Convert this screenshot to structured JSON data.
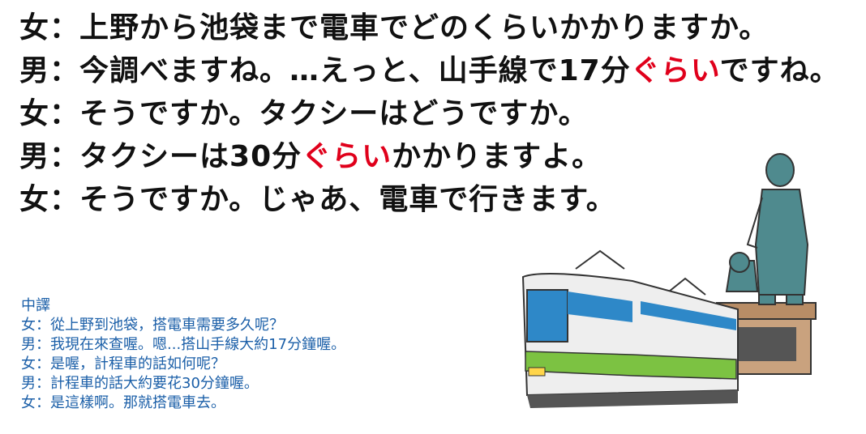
{
  "dialogue": [
    {
      "speaker": "女",
      "sep": "：",
      "segments": [
        {
          "text": "上野から池袋まで電車でどのくらいかかりますか。",
          "highlight": false
        }
      ]
    },
    {
      "speaker": "男",
      "sep": "：",
      "segments": [
        {
          "text": "今調べますね。…えっと、山手線で17分",
          "highlight": false
        },
        {
          "text": "ぐらい",
          "highlight": true
        },
        {
          "text": "ですね。",
          "highlight": false
        }
      ]
    },
    {
      "speaker": "女",
      "sep": "：",
      "segments": [
        {
          "text": "そうですか。タクシーはどうですか。",
          "highlight": false
        }
      ]
    },
    {
      "speaker": "男",
      "sep": "：",
      "segments": [
        {
          "text": "タクシーは30分",
          "highlight": false
        },
        {
          "text": "ぐらい",
          "highlight": true
        },
        {
          "text": "かかりますよ。",
          "highlight": false
        }
      ]
    },
    {
      "speaker": "女",
      "sep": "：",
      "segments": [
        {
          "text": "そうですか。じゃあ、電車で行きます。",
          "highlight": false
        }
      ]
    }
  ],
  "translation": {
    "heading": "中譯",
    "lines": [
      "女：從上野到池袋，搭電車需要多久呢？",
      "男：我現在來查喔。嗯...搭山手線大約17分鐘喔。",
      "女：是喔，計程車的話如何呢？",
      "男：計程車的話大約要花30分鐘喔。",
      "女：是這樣啊。那就搭電車去。"
    ]
  },
  "colors": {
    "highlight": "#e0001b",
    "translation": "#1b5fa8",
    "train_green": "#7cc242",
    "train_blue": "#2e88c8",
    "statue": "#4f8a8e"
  },
  "illustration": {
    "icons": [
      "train-icon",
      "statue-icon",
      "dog-icon"
    ]
  }
}
